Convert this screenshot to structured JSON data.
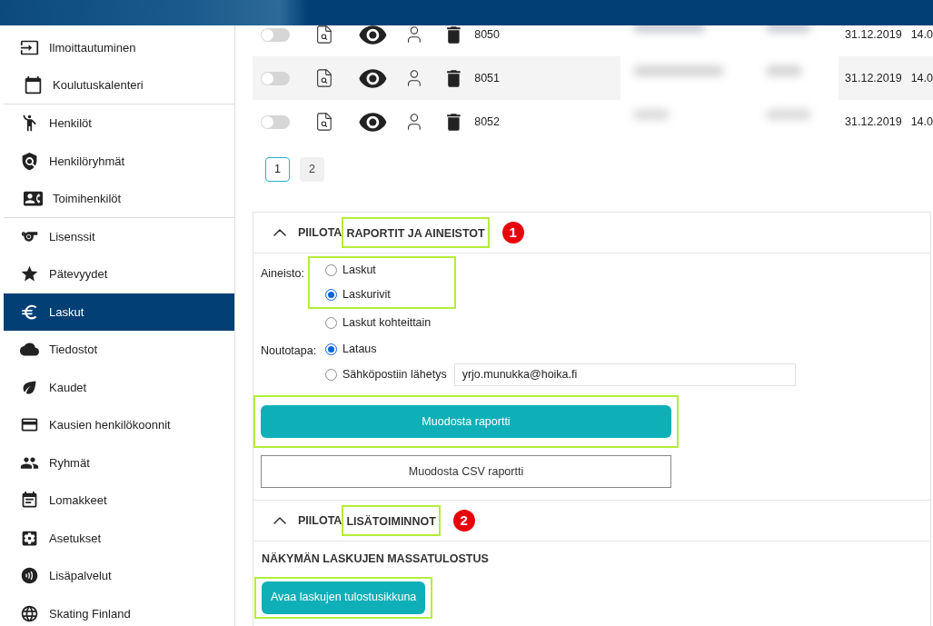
{
  "sidebar": {
    "items": [
      {
        "label": "Ilmoittautuminen",
        "selected": false,
        "divider_below": false
      },
      {
        "label": "Koulutuskalenteri",
        "selected": false,
        "divider_below": true
      },
      {
        "label": "Henkilöt",
        "selected": false,
        "divider_below": false
      },
      {
        "label": "Henkilöryhmät",
        "selected": false,
        "divider_below": false
      },
      {
        "label": "Toimihenkilöt",
        "selected": false,
        "divider_below": true
      },
      {
        "label": "Lisenssit",
        "selected": false,
        "divider_below": false
      },
      {
        "label": "Pätevyydet",
        "selected": false,
        "divider_below": false
      },
      {
        "label": "Laskut",
        "selected": true,
        "divider_below": false
      },
      {
        "label": "Tiedostot",
        "selected": false,
        "divider_below": false
      },
      {
        "label": "Kaudet",
        "selected": false,
        "divider_below": false
      },
      {
        "label": "Kausien henkilökoonnit",
        "selected": false,
        "divider_below": false
      },
      {
        "label": "Ryhmät",
        "selected": false,
        "divider_below": false
      },
      {
        "label": "Lomakkeet",
        "selected": false,
        "divider_below": false
      },
      {
        "label": "Asetukset",
        "selected": false,
        "divider_below": false
      },
      {
        "label": "Lisäpalvelut",
        "selected": false,
        "divider_below": false
      },
      {
        "label": "Skating Finland",
        "selected": false,
        "divider_below": false
      }
    ]
  },
  "table": {
    "rows": [
      {
        "on": false,
        "number": "8050",
        "date": "31.12.2019",
        "column_3": "14.0"
      },
      {
        "on": false,
        "number": "8051",
        "date": "31.12.2019",
        "column_3": "14.0"
      },
      {
        "on": false,
        "number": "8052",
        "date": "31.12.2019",
        "column_3": "14.0"
      }
    ]
  },
  "pagination": {
    "pages": [
      {
        "label": "1",
        "selected": true
      },
      {
        "label": "2",
        "selected": false
      }
    ]
  },
  "reports_section": {
    "toggle": "PIILOTA",
    "title": "RAPORTIT JA AINEISTOT",
    "expanded": true,
    "highlighted": true,
    "annotation": "1",
    "material": {
      "label": "Aineisto:",
      "options": [
        {
          "label": "Laskut",
          "selected": false,
          "highlighted": true
        },
        {
          "label": "Laskurivit",
          "selected": true,
          "highlighted": true
        },
        {
          "label": "Laskut kohteittain",
          "selected": false,
          "highlighted": false
        }
      ]
    },
    "delivery": {
      "label": "Noutotapa:",
      "options": [
        {
          "label": "Lataus",
          "selected": true
        },
        {
          "label": "Sähköpostiin lähetys",
          "selected": false,
          "email": "yrjo.munukka@hoika.fi"
        }
      ]
    },
    "buttons": [
      {
        "label": "Muodosta raportti",
        "kind": "primary",
        "highlighted": true
      },
      {
        "label": "Muodosta CSV raportti",
        "kind": "outline",
        "highlighted": false
      }
    ]
  },
  "extra_section": {
    "toggle": "PIILOTA",
    "title": "LISÄTOIMINNOT",
    "expanded": true,
    "highlighted": true,
    "annotation": "2",
    "heading": "NÄKYMÄN LASKUJEN MASSATULOSTUS",
    "button": {
      "label": "Avaa laskujen tulostusikkuna",
      "highlighted": true
    }
  }
}
